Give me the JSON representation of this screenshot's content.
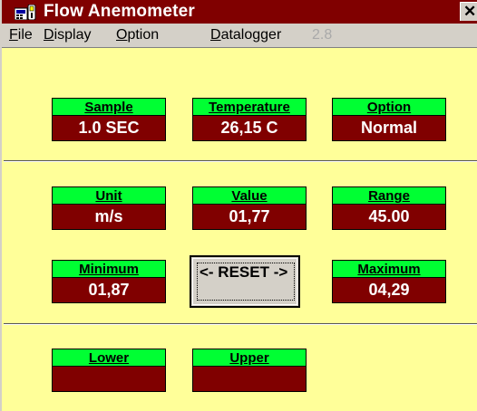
{
  "window": {
    "title": "Flow Anemometer",
    "close_glyph": "✕"
  },
  "menu": {
    "file": {
      "accel": "F",
      "rest": "ile"
    },
    "display": {
      "accel": "D",
      "rest": "isplay"
    },
    "option": {
      "accel": "O",
      "rest": "ption"
    },
    "datalogger": {
      "accel": "D",
      "rest": "atalogger"
    },
    "version": "2.8"
  },
  "fields": {
    "sample": {
      "label": "Sample",
      "value": "1.0 SEC"
    },
    "temperature": {
      "label": "Temperature",
      "value": "26,15 C"
    },
    "option": {
      "label": "Option",
      "value": "Normal"
    },
    "unit": {
      "label": "Unit",
      "value": "m/s"
    },
    "value": {
      "label": "Value",
      "value": "01,77"
    },
    "range": {
      "label": "Range",
      "value": "45.00"
    },
    "minimum": {
      "label": "Minimum",
      "value": "01,87"
    },
    "maximum": {
      "label": "Maximum",
      "value": "04,29"
    },
    "lower": {
      "label": "Lower",
      "value": ""
    },
    "upper": {
      "label": "Upper",
      "value": ""
    }
  },
  "reset_button": {
    "label": "<- RESET ->"
  },
  "colors": {
    "title_bar": "#800000",
    "background": "#ffff99",
    "label_bg": "#00ff33",
    "value_bg": "#800000",
    "value_text": "#ffffff",
    "menu_bg": "#d4d0c8"
  },
  "icons": {
    "app": "anemometer-app-icon",
    "close": "close-icon"
  }
}
